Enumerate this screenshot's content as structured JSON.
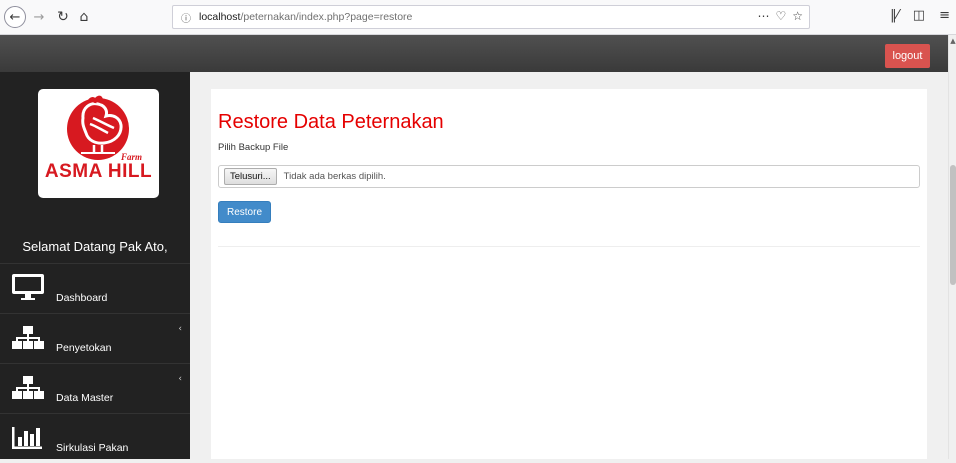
{
  "browser": {
    "url_host": "localhost",
    "url_path": "/peternakan/index.php?page=restore",
    "icons": [
      "back-icon",
      "forward-icon",
      "reload-icon",
      "home-icon",
      "info-icon",
      "more-icon",
      "pocket-icon",
      "bookmark-star-icon",
      "library-icon",
      "sidebar-icon",
      "menu-icon"
    ]
  },
  "header": {
    "logout_label": "logout",
    "logout_color": "#d9534f"
  },
  "sidebar": {
    "logo": {
      "brand": "ASMA HILL",
      "tagline": "Farm",
      "color": "#d71920"
    },
    "welcome": "Selamat Datang Pak Ato,",
    "items": [
      {
        "label": "Dashboard",
        "icon": "monitor-icon",
        "has_submenu": false
      },
      {
        "label": "Penyetokan",
        "icon": "sitemap-icon",
        "has_submenu": true
      },
      {
        "label": "Data Master",
        "icon": "sitemap-icon",
        "has_submenu": true
      },
      {
        "label": "Sirkulasi Pakan",
        "icon": "bar-chart-icon",
        "has_submenu": false
      }
    ]
  },
  "main": {
    "title": "Restore Data Peternakan",
    "title_color": "#e50000",
    "field_label": "Pilih Backup File",
    "browse_label": "Telusuri...",
    "file_status": "Tidak ada berkas dipilih.",
    "restore_label": "Restore",
    "restore_color": "#428bca"
  }
}
